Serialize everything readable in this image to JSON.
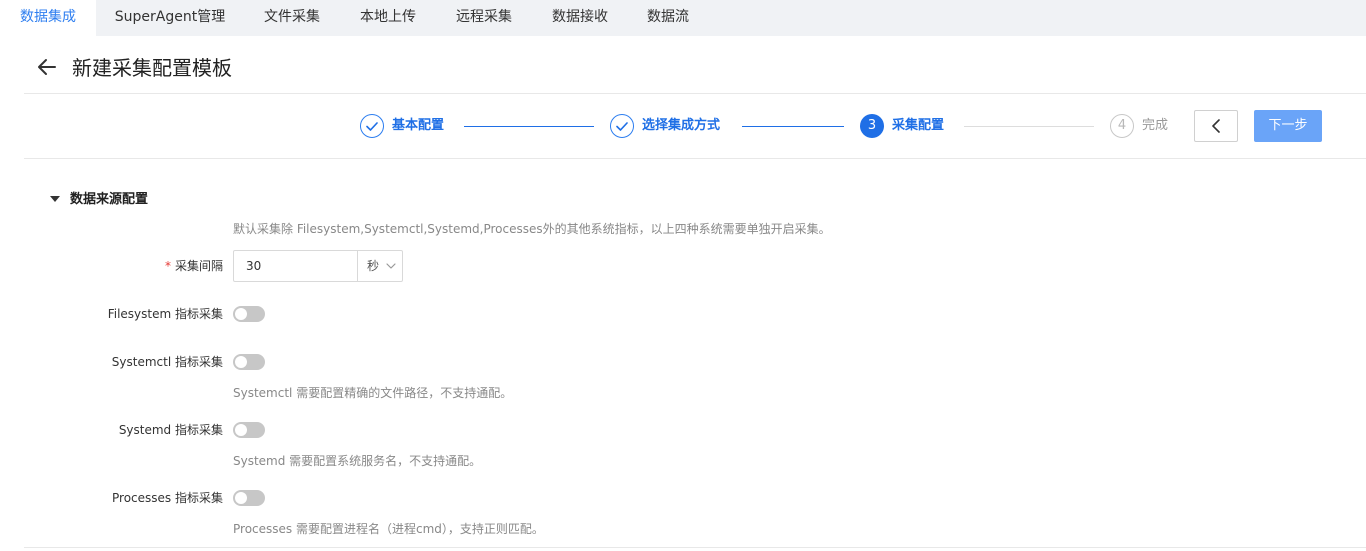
{
  "tabs": [
    {
      "label": "数据集成",
      "active": true
    },
    {
      "label": "SuperAgent管理",
      "active": false
    },
    {
      "label": "文件采集",
      "active": false
    },
    {
      "label": "本地上传",
      "active": false
    },
    {
      "label": "远程采集",
      "active": false
    },
    {
      "label": "数据接收",
      "active": false
    },
    {
      "label": "数据流",
      "active": false
    }
  ],
  "header": {
    "title": "新建采集配置模板",
    "back_icon": "arrow-left-icon"
  },
  "steps": [
    {
      "label": "基本配置",
      "status": "done",
      "icon": "check-icon"
    },
    {
      "label": "选择集成方式",
      "status": "done",
      "icon": "check-icon"
    },
    {
      "number": "3",
      "label": "采集配置",
      "status": "current"
    },
    {
      "number": "4",
      "label": "完成",
      "status": "pending"
    }
  ],
  "actions": {
    "prev_icon": "chevron-left-icon",
    "next_label": "下一步"
  },
  "section": {
    "title": "数据来源配置",
    "collapse_icon": "caret-down-icon",
    "hint": "默认采集除 Filesystem,Systemctl,Systemd,Processes外的其他系统指标，以上四种系统需要单独开启采集。"
  },
  "interval": {
    "required_mark": "*",
    "label": "采集间隔",
    "value": "30",
    "unit": "秒",
    "unit_icon": "chevron-down-icon"
  },
  "toggles": [
    {
      "label": "Filesystem 指标采集",
      "enabled": false,
      "hint": ""
    },
    {
      "label": "Systemctl 指标采集",
      "enabled": false,
      "hint": "Systemctl 需要配置精确的文件路径，不支持通配。"
    },
    {
      "label": "Systemd 指标采集",
      "enabled": false,
      "hint": "Systemd 需要配置系统服务名，不支持通配。"
    },
    {
      "label": "Processes 指标采集",
      "enabled": false,
      "hint": "Processes 需要配置进程名（进程cmd），支持正则匹配。"
    }
  ],
  "colors": {
    "accent": "#1f6fe6",
    "next_button": "#6aa4f8",
    "switch_off": "#c7c7c7",
    "required": "#e53935"
  }
}
